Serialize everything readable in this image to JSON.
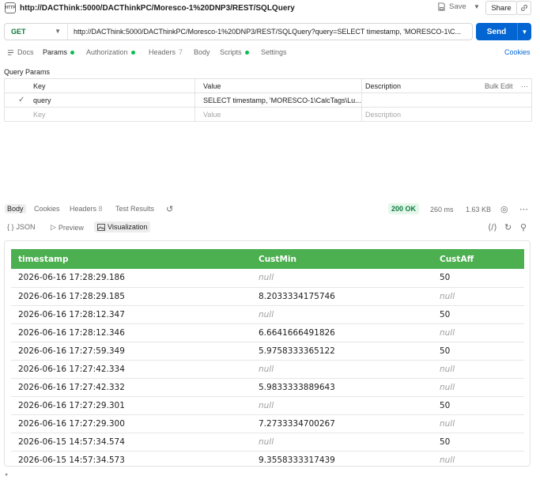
{
  "window": {
    "title": "http://DACThink:5000/DACThinkPC/Moresco-1%20DNP3/REST/SQLQuery",
    "http_icon_text": "HTTP",
    "save_label": "Save",
    "share_label": "Share"
  },
  "request": {
    "method": "GET",
    "url": "http://DACThink:5000/DACThinkPC/Moresco-1%20DNP3/REST/SQLQuery?query=SELECT timestamp, 'MORESCO-1\\C...",
    "send_label": "Send"
  },
  "request_tabs": {
    "docs": "Docs",
    "params": "Params",
    "authorization": "Authorization",
    "headers": "Headers",
    "headers_count": "7",
    "body": "Body",
    "scripts": "Scripts",
    "settings": "Settings",
    "cookies": "Cookies"
  },
  "query_params": {
    "section_label": "Query Params",
    "headers": {
      "key": "Key",
      "value": "Value",
      "description": "Description",
      "bulk_edit": "Bulk Edit",
      "more": "⋯"
    },
    "rows": [
      {
        "key": "query",
        "value": "SELECT timestamp, 'MORESCO-1\\CalcTags\\Lu...",
        "description": ""
      }
    ],
    "placeholder": {
      "key": "Key",
      "value": "Value",
      "description": "Description"
    }
  },
  "response_tabs": {
    "body": "Body",
    "cookies": "Cookies",
    "headers": "Headers",
    "headers_count": "8",
    "test_results": "Test Results",
    "status": "200 OK",
    "time": "260 ms",
    "size": "1.63 KB"
  },
  "view_tabs": {
    "json": "JSON",
    "preview": "Preview",
    "visualization": "Visualization"
  },
  "result_table": {
    "columns": [
      "timestamp",
      "CustMin",
      "CustAff"
    ],
    "rows": [
      [
        "2026-06-16 17:28:29.186",
        "null",
        "50"
      ],
      [
        "2026-06-16 17:28:29.185",
        "8.2033334175746",
        "null"
      ],
      [
        "2026-06-16 17:28:12.347",
        "null",
        "50"
      ],
      [
        "2026-06-16 17:28:12.346",
        "6.6641666491826",
        "null"
      ],
      [
        "2026-06-16 17:27:59.349",
        "5.9758333365122",
        "50"
      ],
      [
        "2026-06-16 17:27:42.334",
        "null",
        "null"
      ],
      [
        "2026-06-16 17:27:42.332",
        "5.9833333889643",
        "null"
      ],
      [
        "2026-06-16 17:27:29.301",
        "null",
        "50"
      ],
      [
        "2026-06-16 17:27:29.300",
        "7.2733334700267",
        "null"
      ],
      [
        "2026-06-15 14:57:34.574",
        "null",
        "50"
      ],
      [
        "2026-06-15 14:57:34.573",
        "9.3558333317439",
        "null"
      ]
    ]
  },
  "colors": {
    "accent": "#0265d2",
    "table_header": "#4caf50",
    "status_ok": "#0c7a3e",
    "active_dot": "#0cbb52"
  }
}
